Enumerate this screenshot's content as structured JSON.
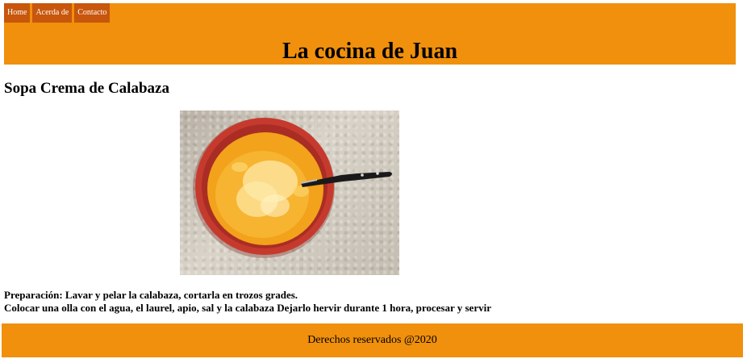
{
  "nav": {
    "items": [
      {
        "label": "Home"
      },
      {
        "label": "Acerda de"
      },
      {
        "label": "Contacto"
      }
    ]
  },
  "header": {
    "title": "La cocina de Juan"
  },
  "recipe": {
    "title": "Sopa Crema de Calabaza",
    "preparation_line1": "Preparación: Lavar y pelar la calabaza, cortarla en trozos grades.",
    "preparation_line2": "Colocar una olla con el agua, el laurel, apio, sal y la calabaza Dejarlo hervir durante 1 hora, procesar y servir"
  },
  "footer": {
    "text": "Derechos reservados @2020"
  },
  "colors": {
    "header_bg": "#f0900c",
    "nav_bg": "#c8560c",
    "footer_bg": "#f0900c"
  }
}
